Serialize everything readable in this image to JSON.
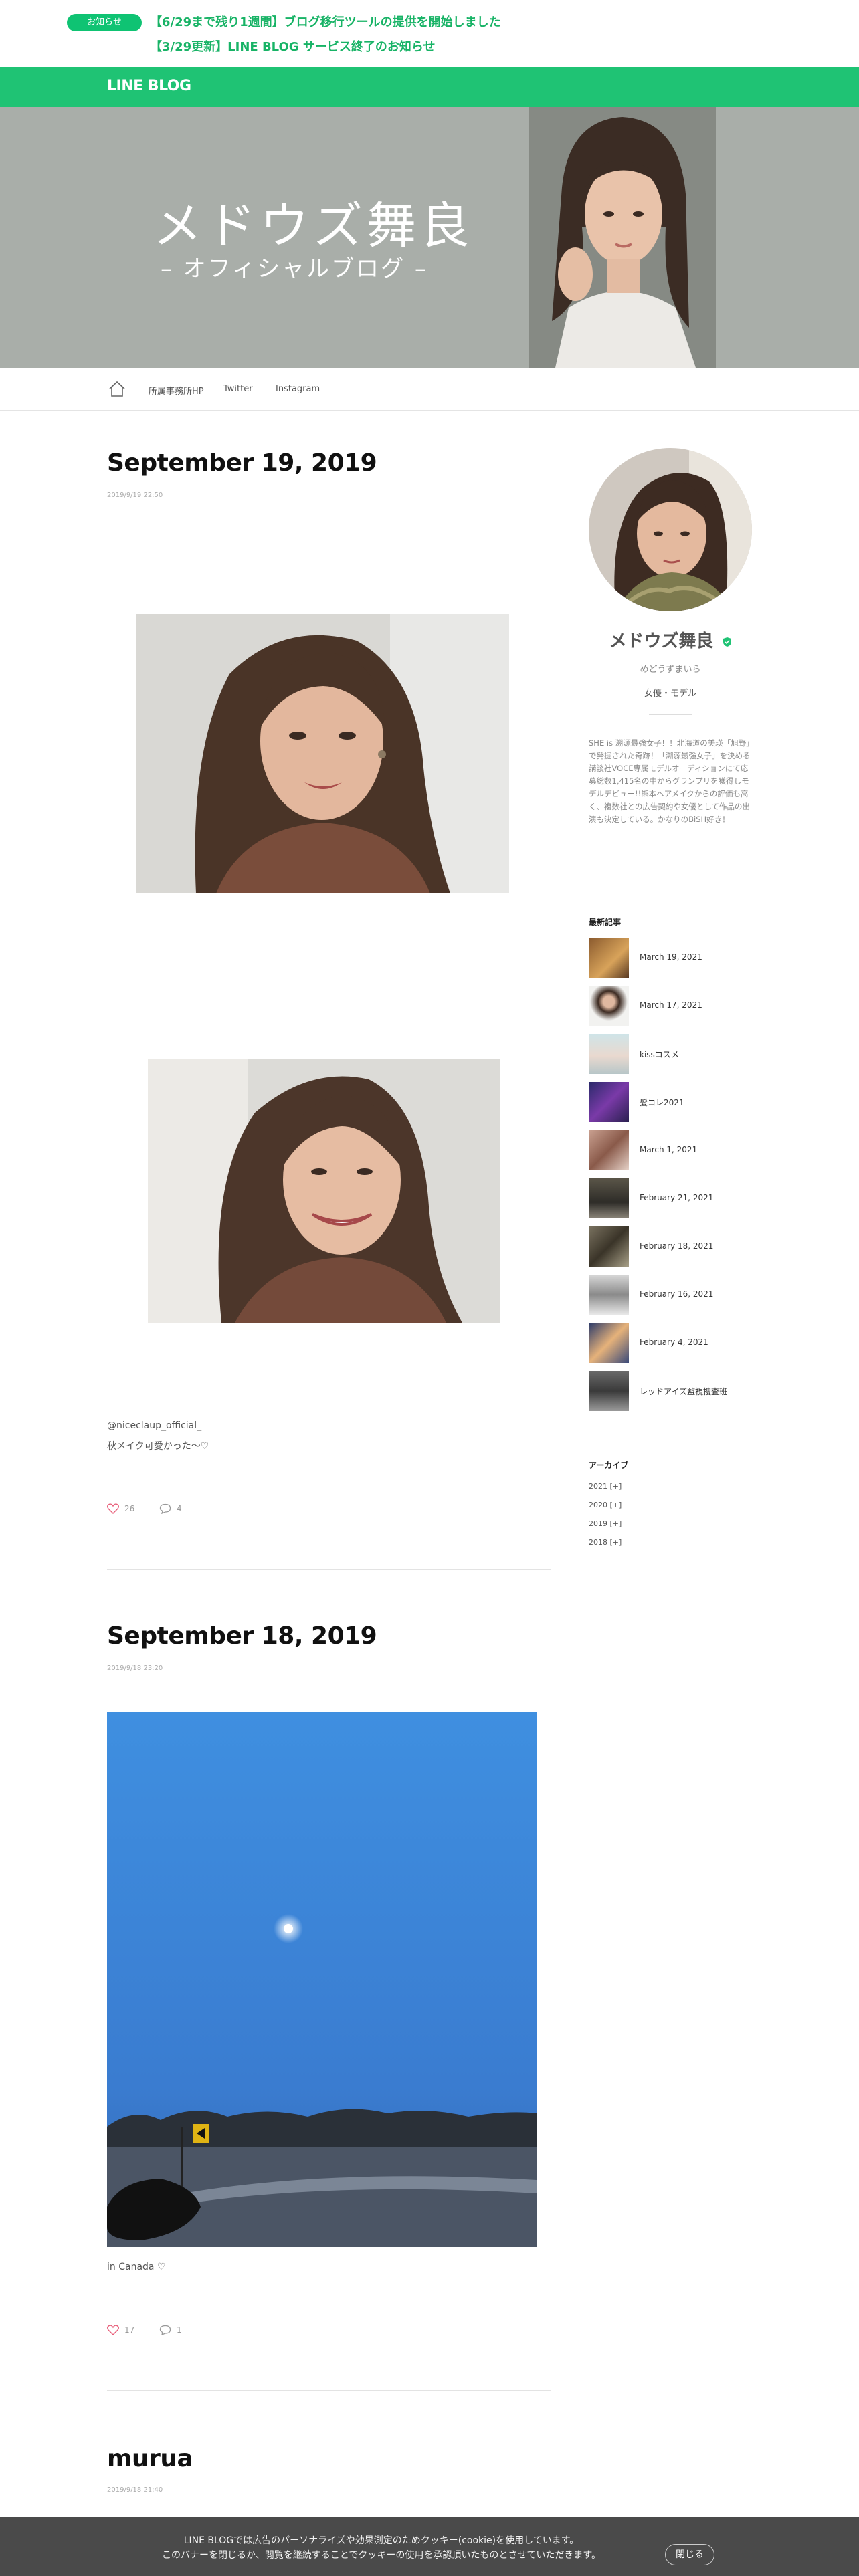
{
  "notice": {
    "badge": "お知らせ",
    "links": [
      "【6/29まで残り1週間】ブログ移行ツールの提供を開始しました",
      "【3/29更新】LINE BLOG サービス終了のお知らせ"
    ]
  },
  "site": {
    "logo": "LINE BLOG"
  },
  "banner": {
    "title": "メドウズ舞良",
    "subtitle": "– オフィシャルブログ –"
  },
  "nav": {
    "links": [
      "所属事務所HP",
      "Twitter",
      "Instagram"
    ]
  },
  "posts": [
    {
      "title": "September 19, 2019",
      "date": "2019/9/19 22:50",
      "caption": [
        "@niceclaup_official_",
        "秋メイク可愛かった〜♡"
      ],
      "likes": "26",
      "comments": "4"
    },
    {
      "title": "September 18, 2019",
      "date": "2019/9/18 23:20",
      "caption": [
        "in Canada ♡"
      ],
      "likes": "17",
      "comments": "1"
    },
    {
      "title": "murua",
      "date": "2019/9/18 21:40"
    }
  ],
  "profile": {
    "name": "メドウズ舞良",
    "kana": "めどうずまいら",
    "role": "女優・モデル",
    "bio": "SHE is 溯源最強女子！！北海道の美瑛「旭野」で発掘された奇跡！「溯源最強女子」を決める講談社VOCE専属モデルオーディションにて応募総数1,415名の中からグランプリを獲得しモデルデビュー!!熊本へアメイクからの評価も高く、複数社との広告契約や女優として作品の出演も決定している。かなりのBiSH好き！"
  },
  "recent": {
    "heading": "最新記事",
    "items": [
      "March 19, 2021",
      "March 17, 2021",
      "kissコスメ",
      "髪コレ2021",
      "March 1, 2021",
      "February 21, 2021",
      "February 18, 2021",
      "February 16, 2021",
      "February 4, 2021",
      "レッドアイズ監視捜査班"
    ]
  },
  "archive": {
    "heading": "アーカイブ",
    "items": [
      "2021 [+]",
      "2020 [+]",
      "2019 [+]",
      "2018 [+]"
    ]
  },
  "cookie": {
    "line1": "LINE BLOGでは広告のパーソナライズや効果測定のためクッキー(cookie)を使用しています。",
    "line2": "このバナーを閉じるか、閲覧を継続することでクッキーの使用を承認頂いたものとさせていただきます。",
    "close": "閉じる"
  },
  "colors": {
    "brand_green": "#1fc374",
    "notice_green": "#18b366",
    "like_pink": "#e8607b"
  }
}
